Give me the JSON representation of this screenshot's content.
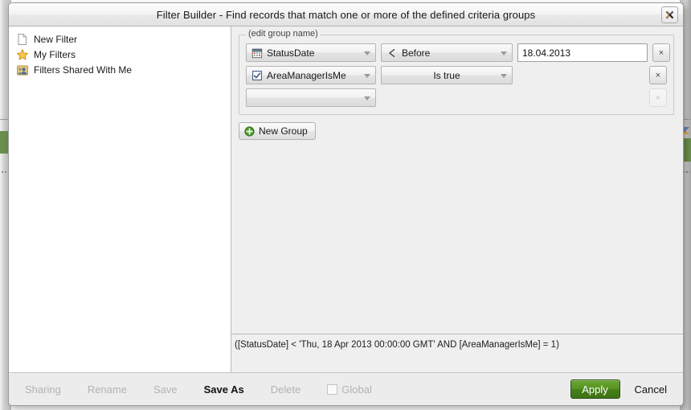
{
  "window": {
    "title": "Filter Builder - Find records that match one or more of the defined criteria groups",
    "close_label": "×"
  },
  "sidebar": {
    "items": [
      {
        "label": "New Filter",
        "icon": "document-icon"
      },
      {
        "label": "My Filters",
        "icon": "star-icon"
      },
      {
        "label": "Filters Shared With Me",
        "icon": "shared-users-icon"
      }
    ]
  },
  "group": {
    "legend": "(edit group name)",
    "rows": [
      {
        "field": "StatusDate",
        "field_icon": "calendar-icon",
        "operator": "Before",
        "operator_icon": "less-than-icon",
        "value": "18.04.2013",
        "remove_label": "×",
        "remove_enabled": true
      },
      {
        "field": "AreaManagerIsMe",
        "field_icon": "checkbox-icon",
        "operator": "Is true",
        "operator_icon": "",
        "value": null,
        "remove_label": "×",
        "remove_enabled": true
      },
      {
        "field": "",
        "field_icon": "",
        "operator": null,
        "operator_icon": "",
        "value": null,
        "remove_label": "×",
        "remove_enabled": false
      }
    ],
    "new_group_label": "New Group",
    "new_group_icon": "plus-circle-icon"
  },
  "expression": "([StatusDate] < 'Thu, 18 Apr 2013 00:00:00 GMT' AND [AreaManagerIsMe] = 1)",
  "footer": {
    "sharing_label": "Sharing",
    "rename_label": "Rename",
    "save_label": "Save",
    "save_as_label": "Save As",
    "delete_label": "Delete",
    "global_label": "Global",
    "apply_label": "Apply",
    "cancel_label": "Cancel"
  },
  "colors": {
    "accent_green": "#56931f",
    "background_green": "#6b8e4e",
    "dialog_bg": "#efefef",
    "sidebar_bg": "#ffffff"
  }
}
